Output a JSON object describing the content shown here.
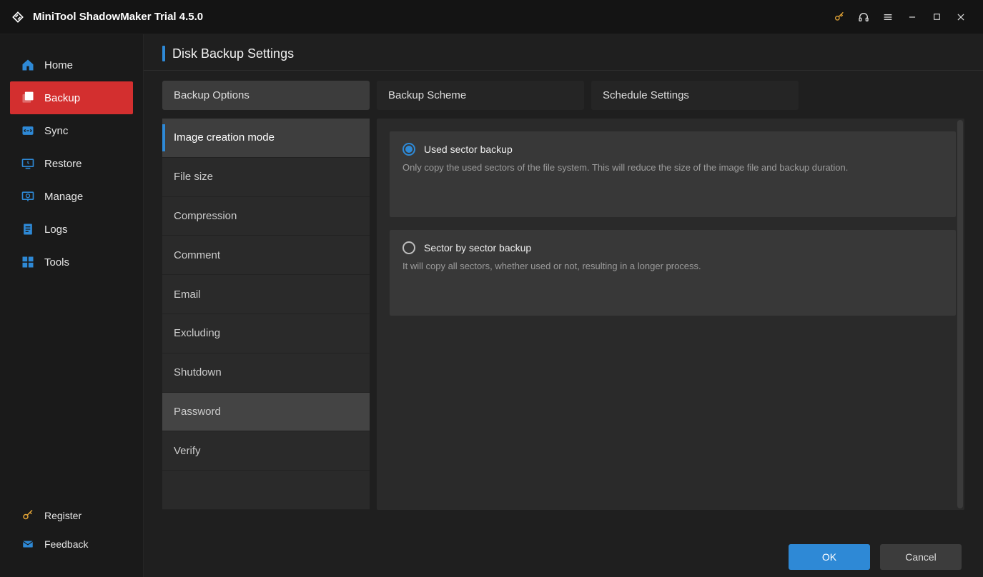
{
  "app_title": "MiniTool ShadowMaker Trial 4.5.0",
  "sidebar": {
    "items": [
      {
        "label": "Home"
      },
      {
        "label": "Backup"
      },
      {
        "label": "Sync"
      },
      {
        "label": "Restore"
      },
      {
        "label": "Manage"
      },
      {
        "label": "Logs"
      },
      {
        "label": "Tools"
      }
    ],
    "footer": {
      "register": "Register",
      "feedback": "Feedback"
    }
  },
  "page_title": "Disk Backup Settings",
  "tabs": {
    "backup_options": "Backup Options",
    "backup_scheme": "Backup Scheme",
    "schedule_settings": "Schedule Settings"
  },
  "options": [
    "Image creation mode",
    "File size",
    "Compression",
    "Comment",
    "Email",
    "Excluding",
    "Shutdown",
    "Password",
    "Verify"
  ],
  "radios": {
    "used": {
      "title": "Used sector backup",
      "desc": "Only copy the used sectors of the file system. This will reduce the size of the image file and backup duration."
    },
    "sector": {
      "title": "Sector by sector backup",
      "desc": "It will copy all sectors, whether used or not, resulting in a longer process."
    }
  },
  "buttons": {
    "ok": "OK",
    "cancel": "Cancel"
  }
}
